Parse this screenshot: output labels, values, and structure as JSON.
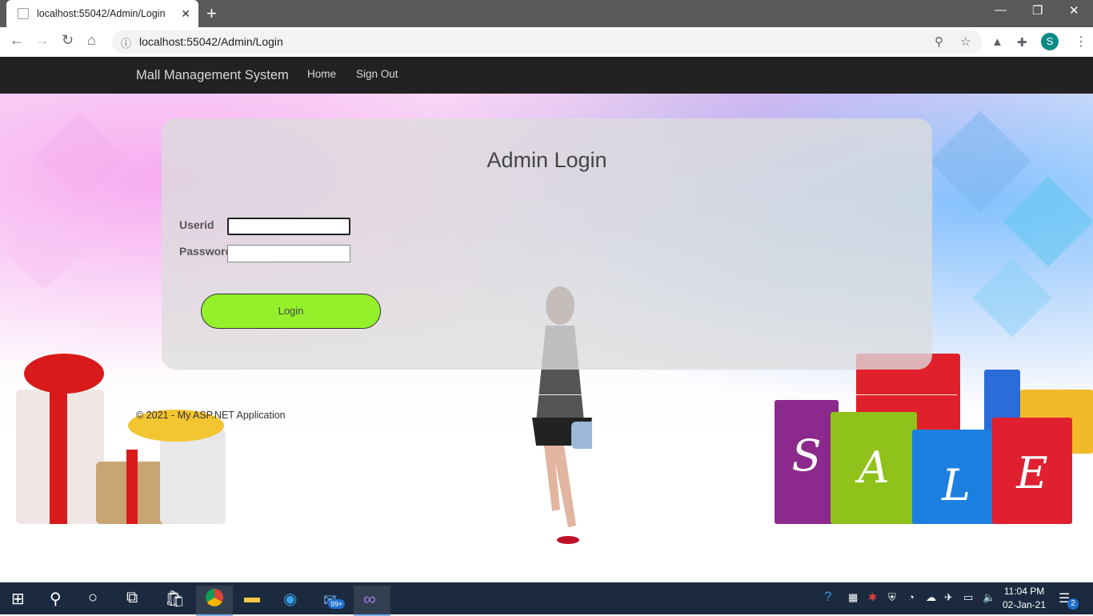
{
  "browser": {
    "tab_title": "localhost:55042/Admin/Login",
    "url": "localhost:55042/Admin/Login",
    "profile_initial": "S"
  },
  "navbar": {
    "brand": "Mall Management System",
    "links": [
      "Home",
      "Sign Out"
    ]
  },
  "login": {
    "title": "Admin Login",
    "userid_label": "Userid",
    "password_label": "Password",
    "userid_value": "",
    "password_value": "",
    "button_label": "Login"
  },
  "decor": {
    "bag_letters": [
      "S",
      "A",
      "L",
      "E"
    ]
  },
  "footer": {
    "text": "© 2021 - My ASP.NET Application"
  },
  "taskbar": {
    "mail_badge": "99+",
    "time": "11:04 PM",
    "date": "02-Jan-21",
    "notification_count": "2"
  },
  "colors": {
    "navbar_bg": "#222222",
    "login_button": "#94f02a",
    "taskbar_bg": "#1b2a3e"
  }
}
